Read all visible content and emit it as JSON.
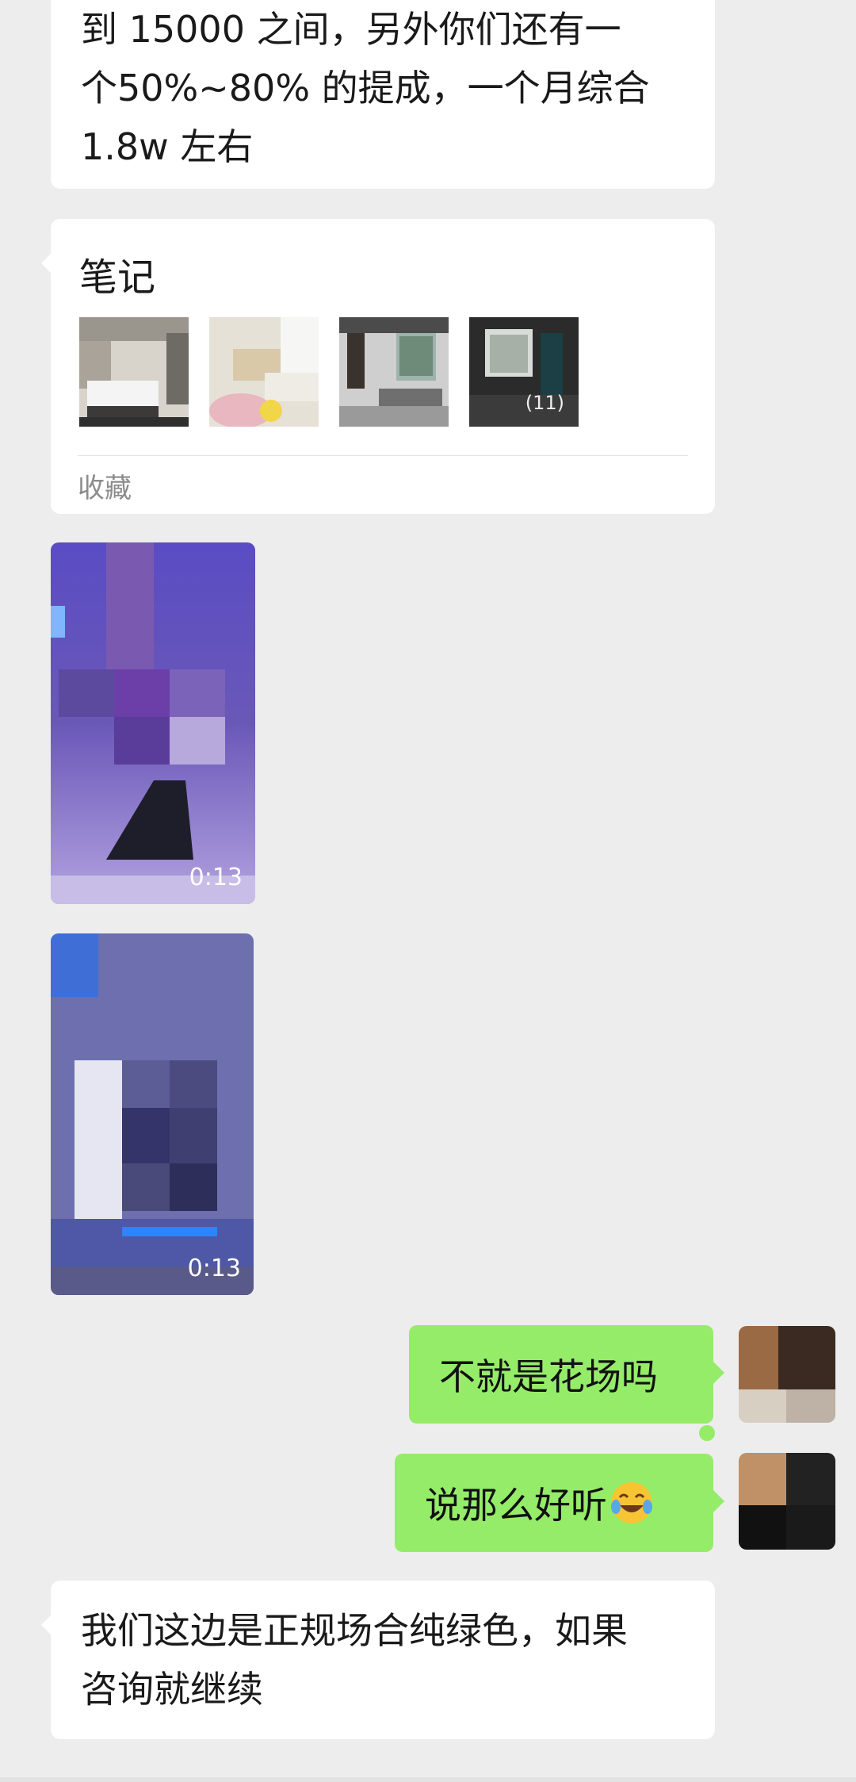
{
  "messages": {
    "top_text": "到 15000 之间，另外你们还有一个50%~80% 的提成，一个月综合 1.8w 左右",
    "top_lines": [
      "到 15000 之间，另外你们还有一",
      "个50%~80% 的提成，一个月综合",
      "1.8w 左右"
    ],
    "note_card": {
      "title": "笔记",
      "image_count": "(11)",
      "footer": "收藏"
    },
    "video_1": {
      "duration": "0:13"
    },
    "video_2": {
      "duration": "0:13"
    },
    "sent_1": "不就是花场吗",
    "sent_2": "说那么好听",
    "sent_2_emoji": "face-with-tears-of-joy-emoji",
    "bottom_lines": [
      "我们这边是正规场合纯绿色，如果",
      "咨询就继续"
    ]
  },
  "colors": {
    "background": "#ededed",
    "incoming_bubble": "#ffffff",
    "outgoing_bubble": "#95ec69",
    "secondary_text": "#8c8c8c"
  }
}
